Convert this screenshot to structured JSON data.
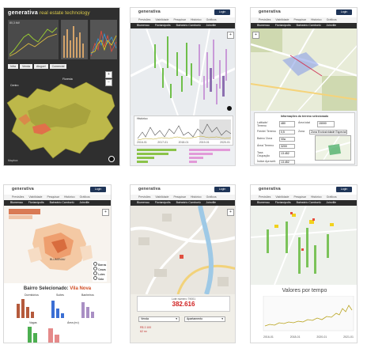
{
  "panel1": {
    "brand_name": "generativa",
    "brand_tagline": "real estate technology",
    "chart1_label": "80,3 kW",
    "layer_tabs": [
      "Infra",
      "Venda",
      "Aluguel",
      "Comercial"
    ],
    "map_label_1": "Floresta",
    "map_label_2": "Centro",
    "zoom_in": "+",
    "zoom_out": "−",
    "footer_logo": "Mapbox",
    "chart_colors": [
      "#f2d21c",
      "#5cb85c",
      "#e74c3c",
      "#3498db"
    ]
  },
  "panel2": {
    "brand": "generativa",
    "login": "Login",
    "menu_top": [
      "Previsões",
      "Viabilidade",
      "Pesquisar",
      "Histórico",
      "Gráficos"
    ],
    "menu_bottom": [
      "Blumenau",
      "Florianópolis",
      "Balneário Camboriú",
      "Joinville"
    ],
    "chart_title": "Histórico",
    "x_ticks": [
      "2016-01",
      "2017-01",
      "2018-01",
      "2019-01",
      "2020-01"
    ],
    "bars_left_colors": [
      "#8bc34a"
    ],
    "bars_right_colors": [
      "#e29ad8"
    ]
  },
  "panel3": {
    "brand": "generativa",
    "login": "Login",
    "menu_top": [
      "Previsões",
      "Viabilidade",
      "Pesquisar",
      "Histórico",
      "Gráficos"
    ],
    "menu_bottom": [
      "Blumenau",
      "Florianópolis",
      "Balneário Camboriú",
      "Joinville"
    ],
    "info_title": "Informações do terreno selecionado",
    "fields": [
      {
        "label": "Latitude/ Terreno",
        "value": "480"
      },
      {
        "label": "Área total",
        "value": "15000"
      },
      {
        "label": "Frente/ Terreno",
        "value": "0,5"
      },
      {
        "label": "Zona",
        "value": "Zona Exclusividade Especial"
      },
      {
        "label": "Bairro/ Zona",
        "value": "Vila"
      },
      {
        "label": "Área/ Terreno",
        "value": "3200"
      },
      {
        "label": "Taxa Ocupação",
        "value": "13.452"
      },
      {
        "label": "Índice Aproveit.",
        "value": "13.452"
      }
    ]
  },
  "panel4": {
    "brand": "generativa",
    "login": "Login",
    "menu_top": [
      "Previsões",
      "Viabilidade",
      "Pesquisar",
      "Histórico",
      "Gráficos"
    ],
    "menu_bottom": [
      "Blumenau",
      "Florianópolis",
      "Balneário Camboriú",
      "Joinville"
    ],
    "legend": [
      "Barras",
      "Casas",
      "Lotes",
      "Sala"
    ],
    "selected_prefix": "Bairro Selecionado:",
    "selected_name": "Vila Nova",
    "map_label": "BLUMENAU",
    "chart_titles": [
      "Dormitórios",
      "Suítes",
      "Banheiros",
      "Vagas",
      "Área (m²)"
    ],
    "bar_colors": [
      "#b55a3c",
      "#3b6fd4",
      "#a98fc4",
      "#4caf50",
      "#e58a8a"
    ]
  },
  "panel5": {
    "brand": "generativa",
    "login": "Login",
    "menu_top": [
      "Previsões",
      "Viabilidade",
      "Pesquisar",
      "Histórico",
      "Gráficos"
    ],
    "menu_bottom": [
      "Blumenau",
      "Florianópolis",
      "Balneário Camboriú",
      "Joinville"
    ],
    "price_label": "Lote número 79001",
    "price_value": "382.616",
    "select_1": "Venda",
    "select_2": "Apartamento",
    "stat_1": "R$ 2.100",
    "stat_2": "62 m²"
  },
  "panel6": {
    "brand": "generativa",
    "login": "Login",
    "menu_top": [
      "Previsões",
      "Viabilidade",
      "Pesquisar",
      "Histórico",
      "Gráficos"
    ],
    "menu_bottom": [
      "Blumenau",
      "Florianópolis",
      "Balneário Camboriú",
      "Joinville"
    ],
    "chart_title": "Valores por tempo",
    "x_ticks": [
      "2016-01",
      "2018-01",
      "2020-01",
      "2021-01"
    ],
    "line_color": "#b8a21a"
  }
}
